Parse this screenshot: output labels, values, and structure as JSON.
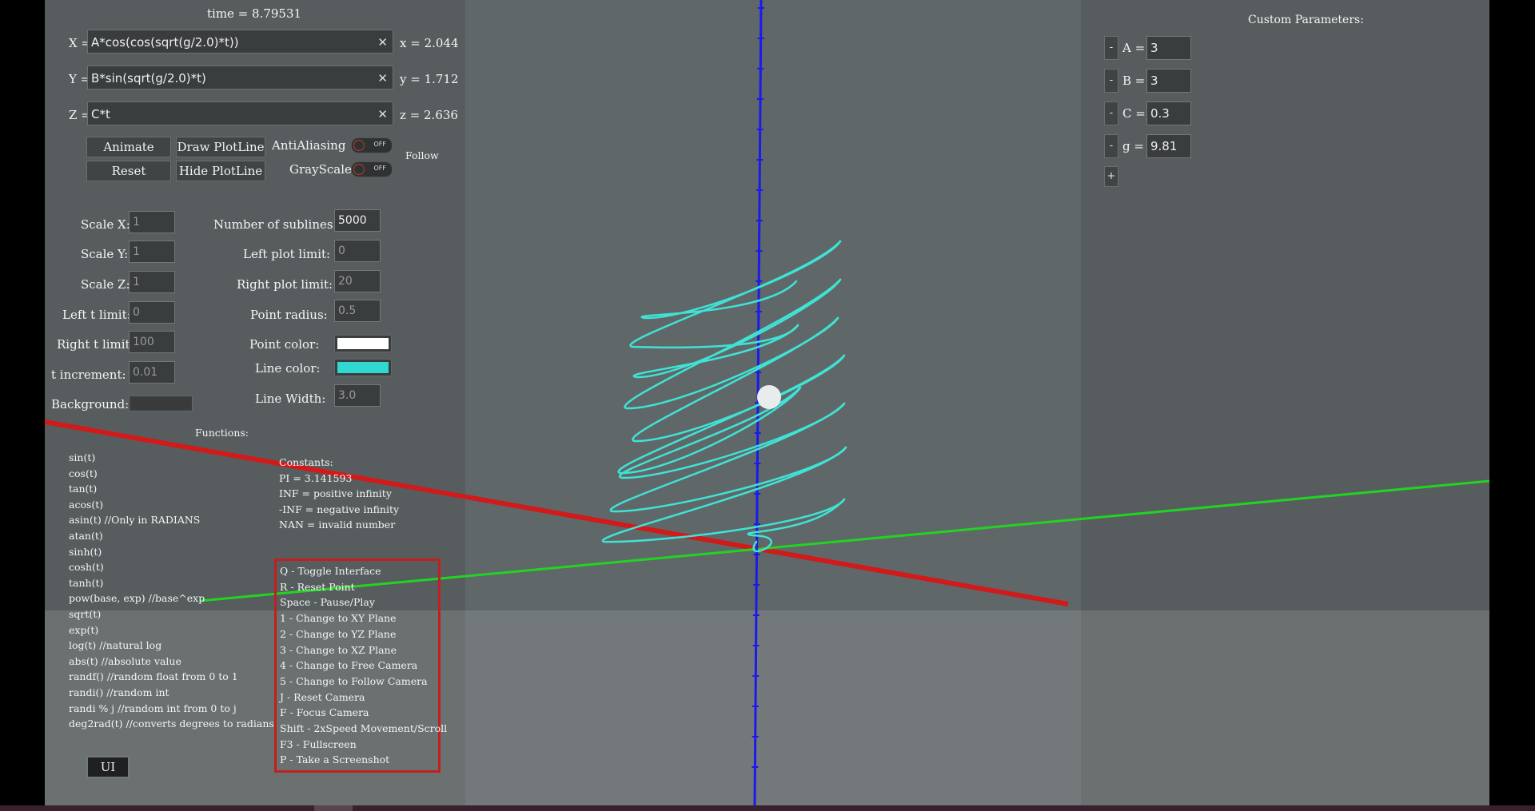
{
  "time_label": "time = 8.79531",
  "expressions": [
    {
      "label": "X =",
      "expr": "A*cos(cos(sqrt(g/2.0)*t))",
      "result": "x = 2.044"
    },
    {
      "label": "Y =",
      "expr": "B*sin(sqrt(g/2.0)*t)",
      "result": "y = 1.712"
    },
    {
      "label": "Z =",
      "expr": "C*t",
      "result": "z = 2.636"
    }
  ],
  "clear_glyph": "✕",
  "buttons": {
    "animate": "Animate",
    "reset": "Reset",
    "draw_plotline": "Draw PlotLine",
    "hide_plotline": "Hide PlotLine",
    "ui": "UI"
  },
  "toggles": {
    "antialiasing": {
      "label": "AntiAliasing",
      "state": "OFF"
    },
    "grayscale": {
      "label": "GrayScale",
      "state": "OFF"
    }
  },
  "follow_label": "Follow",
  "settings_left": [
    {
      "label": "Scale X:",
      "value": "1"
    },
    {
      "label": "Scale Y:",
      "value": "1"
    },
    {
      "label": "Scale Z:",
      "value": "1"
    },
    {
      "label": "Left t limit:",
      "value": "0"
    },
    {
      "label": "Right t limit:",
      "value": "100"
    },
    {
      "label": "t  increment:",
      "value": "0.01"
    }
  ],
  "background_label": "Background:",
  "background_color": "#3a3a3a",
  "settings_right": [
    {
      "label": "Number of sublines:",
      "value": "5000"
    },
    {
      "label": "Left plot limit:",
      "value": "0"
    },
    {
      "label": "Right plot limit:",
      "value": "20"
    },
    {
      "label": "Point radius:",
      "value": "0.5"
    }
  ],
  "point_color": {
    "label": "Point color:",
    "color": "#ffffff"
  },
  "line_color": {
    "label": "Line color:",
    "color": "#2fd8d0"
  },
  "line_width": {
    "label": "Line Width:",
    "value": "3.0"
  },
  "functions_title": "Functions:",
  "functions": [
    "sin(t)",
    "cos(t)",
    "tan(t)",
    "acos(t)",
    "asin(t)     //Only in RADIANS",
    "atan(t)",
    "sinh(t)",
    "cosh(t)",
    "tanh(t)",
    "pow(base, exp)   //base^exp",
    "sqrt(t)",
    "exp(t)",
    "log(t)   //natural log",
    "abs(t)   //absolute value",
    "randf()   //random float from 0 to 1",
    "randi()   //random int",
    "randi % j   //random int from 0 to j",
    "deg2rad(t)   //converts degrees to radians"
  ],
  "constants": [
    "Constants:",
    "PI = 3.141593",
    "INF = positive infinity",
    "-INF = negative infinity",
    "NAN = invalid number"
  ],
  "shortcuts": [
    "Q - Toggle Interface",
    "R - Reset Point",
    "Space - Pause/Play",
    "1 - Change to XY Plane",
    "2 - Change to YZ Plane",
    "3 - Change to XZ Plane",
    "4 - Change to Free Camera",
    "5 - Change to Follow Camera",
    "J - Reset Camera",
    "F - Focus Camera",
    "Shift - 2xSpeed Movement/Scroll",
    "F3 - Fullscreen",
    "P - Take a Screenshot"
  ],
  "custom_params": {
    "title": "Custom Parameters:",
    "minus_label": "-",
    "add_label": "+",
    "items": [
      {
        "name": "A =",
        "value": "3"
      },
      {
        "name": "B =",
        "value": "3"
      },
      {
        "name": "C =",
        "value": "0.3"
      },
      {
        "name": "g =",
        "value": "9.81"
      }
    ]
  },
  "colors": {
    "x_axis": "#d11a1a",
    "y_axis": "#22d422",
    "z_axis": "#1a1aee",
    "curve": "#3fe3d6",
    "point": "#e8ecec"
  }
}
